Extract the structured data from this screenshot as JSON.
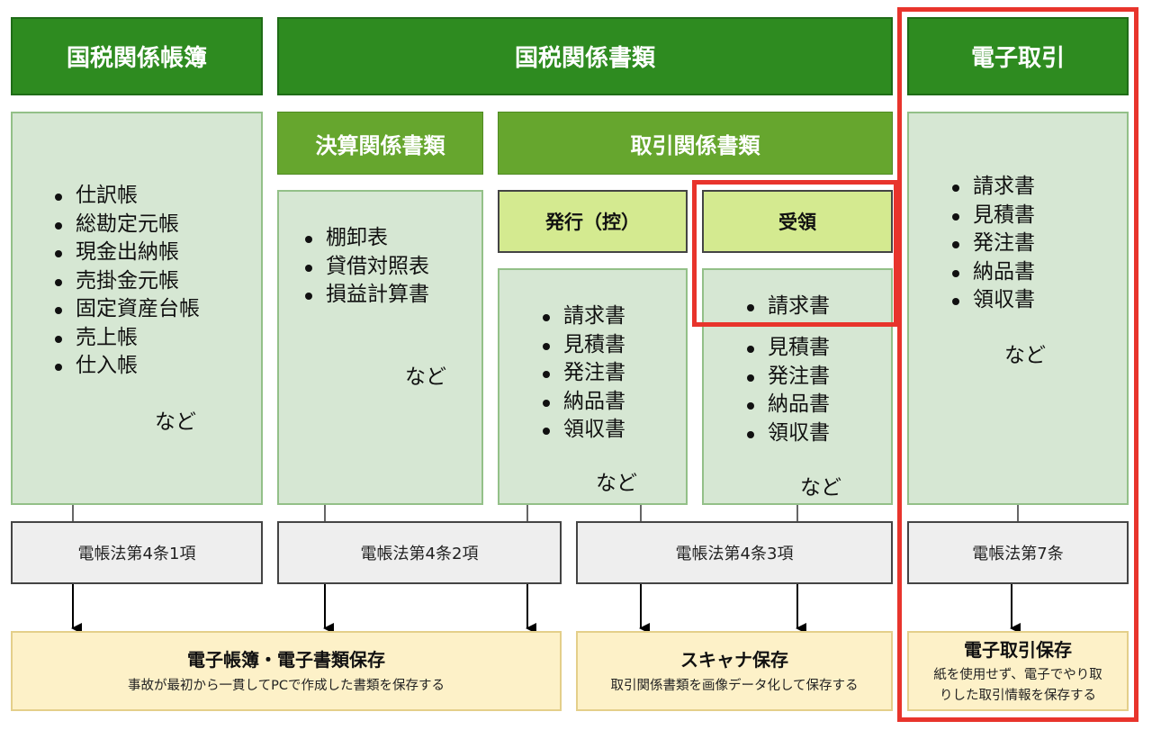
{
  "headers": {
    "books": "国税関係帳簿",
    "documents": "国税関係書類",
    "etrans": "電子取引"
  },
  "subheaders": {
    "settlement": "決算関係書類",
    "transaction": "取引関係書類",
    "issued": "発行（控）",
    "received": "受領"
  },
  "lists": {
    "books": [
      "仕訳帳",
      "総勘定元帳",
      "現金出納帳",
      "売掛金元帳",
      "固定資産台帳",
      "売上帳",
      "仕入帳"
    ],
    "settlement": [
      "棚卸表",
      "貸借対照表",
      "損益計算書"
    ],
    "issued": [
      "請求書",
      "見積書",
      "発注書",
      "納品書",
      "領収書"
    ],
    "received_highlight": [
      "請求書"
    ],
    "received": [
      "見積書",
      "発注書",
      "納品書",
      "領収書"
    ],
    "etrans": [
      "請求書",
      "見積書",
      "発注書",
      "納品書",
      "領収書"
    ]
  },
  "etc": "など",
  "laws": {
    "a": "電帳法第4条1項",
    "b": "電帳法第4条2項",
    "c": "電帳法第4条3項",
    "d": "電帳法第7条"
  },
  "results": {
    "ebook": {
      "title": "電子帳簿・電子書類保存",
      "desc": "事故が最初から一貫してPCで作成した書類を保存する"
    },
    "scan": {
      "title": "スキャナ保存",
      "desc": "取引関係書類を画像データ化して保存する"
    },
    "etrans": {
      "title": "電子取引保存",
      "desc_line1": "紙を使用せず、電子でやり取",
      "desc_line2": "りした取引情報を保存する"
    }
  },
  "colors": {
    "header_green": "#2e8b20",
    "sub_green": "#66a62e",
    "lime": "#d4ea90",
    "panel": "#d6e7d3",
    "result": "#fdf1c8",
    "highlight_red": "#e8342c"
  }
}
